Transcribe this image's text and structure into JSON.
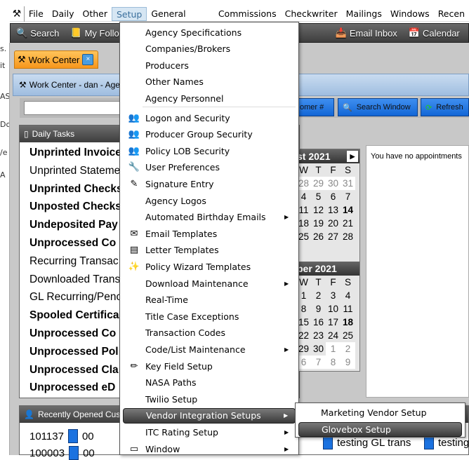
{
  "menubar": {
    "items": [
      "File",
      "Daily",
      "Other",
      "Setup",
      "General Ledger",
      "Commissions",
      "Checkwriter",
      "Mailings",
      "Windows",
      "Recen"
    ],
    "active": "Setup"
  },
  "toolbar": {
    "items": [
      {
        "label": "Search",
        "icon": "magnifier-icon"
      },
      {
        "label": "My Follo",
        "icon": "notepad-icon"
      },
      {
        "label": "Email Inbox",
        "icon": "inbox-icon"
      },
      {
        "label": "Calendar",
        "icon": "calendar-icon"
      }
    ]
  },
  "left_strip": [
    "s.",
    "it",
    "AS",
    "Dc",
    "/e",
    "A"
  ],
  "tab": {
    "label": "Work Center"
  },
  "window": {
    "title": "Work Center - dan - Ager"
  },
  "search_row": {
    "buttons": [
      "omer #",
      "Search Window",
      "Refresh"
    ]
  },
  "tasks": {
    "title": "Daily Tasks",
    "items": [
      {
        "label": "Unprinted Invoice",
        "bold": true
      },
      {
        "label": "Unprinted Stateme",
        "bold": false
      },
      {
        "label": "Unprinted Checks",
        "bold": true
      },
      {
        "label": "Unposted Checks",
        "bold": true
      },
      {
        "label": "Undeposited Pay",
        "bold": true
      },
      {
        "label": "Unprocessed Co",
        "bold": true
      },
      {
        "label": "Recurring Transac",
        "bold": false
      },
      {
        "label": "Downloaded Trans",
        "bold": false
      },
      {
        "label": "GL Recurring/Penc",
        "bold": false
      },
      {
        "label": "Spooled Certifica",
        "bold": true
      },
      {
        "label": "Unprocessed Co",
        "bold": true
      },
      {
        "label": "Unprocessed Pol",
        "bold": true
      },
      {
        "label": "Unprocessed Cla",
        "bold": true
      },
      {
        "label": "Unprocessed eD",
        "bold": true
      }
    ]
  },
  "calendar": {
    "month1": {
      "title": "st 2021",
      "days_header": [
        "W",
        "T",
        "F",
        "S"
      ],
      "rows": [
        [
          "28",
          "29",
          "30",
          "31"
        ],
        [
          "4",
          "5",
          "6",
          "7"
        ],
        [
          "11",
          "12",
          "13",
          "14"
        ],
        [
          "18",
          "19",
          "20",
          "21"
        ],
        [
          "25",
          "26",
          "27",
          "28"
        ]
      ]
    },
    "month2": {
      "title": "ber 2021",
      "days_header": [
        "W",
        "T",
        "F",
        "S"
      ],
      "rows": [
        [
          "1",
          "2",
          "3",
          "4"
        ],
        [
          "8",
          "9",
          "10",
          "11"
        ],
        [
          "15",
          "16",
          "17",
          "18"
        ],
        [
          "22",
          "23",
          "24",
          "25"
        ],
        [
          "29",
          "30",
          "1",
          "2"
        ],
        [
          "6",
          "7",
          "8",
          "9"
        ]
      ]
    }
  },
  "appointments": {
    "text": "You have no appointments"
  },
  "recent": {
    "title": "Recently Opened Custo",
    "rows": [
      {
        "id": "101137",
        "code": "00"
      },
      {
        "id": "100003",
        "code": "00"
      }
    ],
    "right_cells": [
      "testing GL trans",
      "testing"
    ]
  },
  "setup_menu": {
    "items": [
      {
        "label": "Agency Specifications",
        "icon": "",
        "sub": false
      },
      {
        "label": "Companies/Brokers",
        "icon": "",
        "sub": false
      },
      {
        "label": "Producers",
        "icon": "",
        "sub": false
      },
      {
        "label": "Other Names",
        "icon": "",
        "sub": false
      },
      {
        "label": "Agency Personnel",
        "icon": "",
        "sub": false
      },
      {
        "label": "Logon and Security",
        "icon": "users-key-icon",
        "sub": false
      },
      {
        "label": "Producer Group Security",
        "icon": "users-icon",
        "sub": false
      },
      {
        "label": "Policy LOB Security",
        "icon": "users-icon",
        "sub": false
      },
      {
        "label": "User Preferences",
        "icon": "wrench-icon",
        "sub": false
      },
      {
        "label": "Signature Entry",
        "icon": "pen-icon",
        "sub": false
      },
      {
        "label": "Agency Logos",
        "icon": "",
        "sub": false
      },
      {
        "label": "Automated Birthday Emails",
        "icon": "",
        "sub": true
      },
      {
        "label": "Email Templates",
        "icon": "envelope-icon",
        "sub": false
      },
      {
        "label": "Letter Templates",
        "icon": "letter-icon",
        "sub": false
      },
      {
        "label": "Policy Wizard Templates",
        "icon": "wand-icon",
        "sub": false
      },
      {
        "label": "Download Maintenance",
        "icon": "",
        "sub": true
      },
      {
        "label": "Real-Time",
        "icon": "",
        "sub": false
      },
      {
        "label": "Title Case Exceptions",
        "icon": "",
        "sub": false
      },
      {
        "label": "Transaction Codes",
        "icon": "",
        "sub": false
      },
      {
        "label": "Code/List Maintenance",
        "icon": "",
        "sub": true
      },
      {
        "label": "Key Field Setup",
        "icon": "highlighter-icon",
        "sub": false
      },
      {
        "label": "NASA Paths",
        "icon": "",
        "sub": false
      },
      {
        "label": "Twilio Setup",
        "icon": "",
        "sub": false
      },
      {
        "label": "Vendor Integration Setups",
        "icon": "",
        "sub": true,
        "highlighted": true
      },
      {
        "label": "ITC Rating Setup",
        "icon": "",
        "sub": true
      },
      {
        "label": "Window",
        "icon": "window-icon",
        "sub": true
      }
    ]
  },
  "submenu": {
    "items": [
      {
        "label": "Marketing Vendor Setup"
      },
      {
        "label": "Glovebox Setup",
        "highlighted": true
      }
    ]
  }
}
